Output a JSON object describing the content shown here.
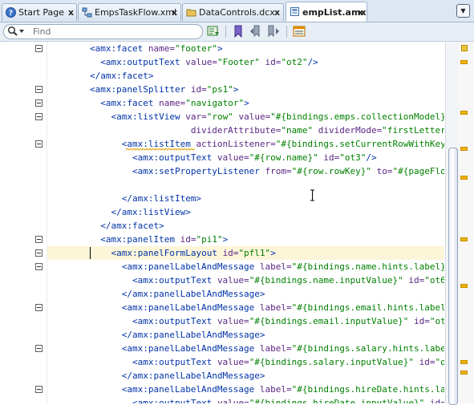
{
  "tabs": [
    {
      "label": "Start Page",
      "icon": "help-icon",
      "active": false
    },
    {
      "label": "EmpsTaskFlow.xml",
      "icon": "taskflow-icon",
      "active": false
    },
    {
      "label": "DataControls.dcx",
      "icon": "folder-icon",
      "active": false
    },
    {
      "label": "empList.amx",
      "icon": "amx-file-icon",
      "active": true
    }
  ],
  "tab_close_glyph": "x",
  "tab_menu_glyph": "▼",
  "find": {
    "placeholder": "Find",
    "value": ""
  },
  "toolbar_icons": [
    "search-options-icon",
    "bookmark-icon",
    "previous-bookmark-icon",
    "next-bookmark-icon",
    "layout-icon"
  ],
  "code_lines": [
    [
      {
        "k": "p",
        "t": "        "
      },
      {
        "k": "t",
        "t": "<amx:facet "
      },
      {
        "k": "a",
        "t": "name="
      },
      {
        "k": "v",
        "t": "\"footer\""
      },
      {
        "k": "t",
        "t": ">"
      }
    ],
    [
      {
        "k": "p",
        "t": "          "
      },
      {
        "k": "t",
        "t": "<amx:outputText "
      },
      {
        "k": "a",
        "t": "value="
      },
      {
        "k": "v",
        "t": "\"Footer\""
      },
      {
        "k": "a",
        "t": " id="
      },
      {
        "k": "v",
        "t": "\"ot2\""
      },
      {
        "k": "t",
        "t": "/>"
      }
    ],
    [
      {
        "k": "p",
        "t": "        "
      },
      {
        "k": "t",
        "t": "</amx:facet>"
      }
    ],
    [
      {
        "k": "p",
        "t": "        "
      },
      {
        "k": "t",
        "t": "<amx:panelSplitter "
      },
      {
        "k": "a",
        "t": "id="
      },
      {
        "k": "v",
        "t": "\"ps1\""
      },
      {
        "k": "t",
        "t": ">"
      }
    ],
    [
      {
        "k": "p",
        "t": "          "
      },
      {
        "k": "t",
        "t": "<amx:facet "
      },
      {
        "k": "a",
        "t": "name="
      },
      {
        "k": "v",
        "t": "\"navigator\""
      },
      {
        "k": "t",
        "t": ">"
      }
    ],
    [
      {
        "k": "p",
        "t": "            "
      },
      {
        "k": "t",
        "t": "<amx:listView "
      },
      {
        "k": "a",
        "t": "var="
      },
      {
        "k": "v",
        "t": "\"row\""
      },
      {
        "k": "a",
        "t": " value="
      },
      {
        "k": "v",
        "t": "\"#{bindings.emps.collectionModel}"
      }
    ],
    [
      {
        "k": "p",
        "t": "                           "
      },
      {
        "k": "a",
        "t": "dividerAttribute="
      },
      {
        "k": "v",
        "t": "\"name\""
      },
      {
        "k": "a",
        "t": " dividerMode="
      },
      {
        "k": "v",
        "t": "\"firstLetter\""
      }
    ],
    [
      {
        "k": "p",
        "t": "              "
      },
      {
        "k": "t",
        "t": "<amx:listItem "
      },
      {
        "k": "a",
        "t": "actionListener="
      },
      {
        "k": "v",
        "t": "\"#{bindings.setCurrentRowWithKey"
      }
    ],
    [
      {
        "k": "p",
        "t": "                "
      },
      {
        "k": "t",
        "t": "<amx:outputText "
      },
      {
        "k": "a",
        "t": "value="
      },
      {
        "k": "v",
        "t": "\"#{row.name}\""
      },
      {
        "k": "a",
        "t": " id="
      },
      {
        "k": "v",
        "t": "\"ot3\""
      },
      {
        "k": "t",
        "t": "/>"
      }
    ],
    [
      {
        "k": "p",
        "t": "                "
      },
      {
        "k": "t",
        "t": "<amx:setPropertyListener "
      },
      {
        "k": "a",
        "t": "from="
      },
      {
        "k": "v",
        "t": "\"#{row.rowKey}\""
      },
      {
        "k": "a",
        "t": " to="
      },
      {
        "k": "v",
        "t": "\"#{pageFlo"
      }
    ],
    [],
    [
      {
        "k": "p",
        "t": "              "
      },
      {
        "k": "t",
        "t": "</amx:listItem>"
      }
    ],
    [
      {
        "k": "p",
        "t": "            "
      },
      {
        "k": "t",
        "t": "</amx:listView>"
      }
    ],
    [
      {
        "k": "p",
        "t": "          "
      },
      {
        "k": "t",
        "t": "</amx:facet>"
      }
    ],
    [
      {
        "k": "p",
        "t": "          "
      },
      {
        "k": "t",
        "t": "<amx:panelItem "
      },
      {
        "k": "a",
        "t": "id="
      },
      {
        "k": "v",
        "t": "\"pi1\""
      },
      {
        "k": "t",
        "t": ">"
      }
    ],
    [
      {
        "k": "p",
        "t": "            "
      },
      {
        "k": "t",
        "t": "<amx:panelFormLayout "
      },
      {
        "k": "a",
        "t": "id="
      },
      {
        "k": "v",
        "t": "\"pfl1\""
      },
      {
        "k": "t",
        "t": ">"
      }
    ],
    [
      {
        "k": "p",
        "t": "              "
      },
      {
        "k": "t",
        "t": "<amx:panelLabelAndMessage "
      },
      {
        "k": "a",
        "t": "label="
      },
      {
        "k": "v",
        "t": "\"#{bindings.name.hints.label}"
      }
    ],
    [
      {
        "k": "p",
        "t": "                "
      },
      {
        "k": "t",
        "t": "<amx:outputText "
      },
      {
        "k": "a",
        "t": "value="
      },
      {
        "k": "v",
        "t": "\"#{bindings.name.inputValue}\""
      },
      {
        "k": "a",
        "t": " id="
      },
      {
        "k": "v",
        "t": "\"ot6"
      }
    ],
    [
      {
        "k": "p",
        "t": "              "
      },
      {
        "k": "t",
        "t": "</amx:panelLabelAndMessage>"
      }
    ],
    [
      {
        "k": "p",
        "t": "              "
      },
      {
        "k": "t",
        "t": "<amx:panelLabelAndMessage "
      },
      {
        "k": "a",
        "t": "label="
      },
      {
        "k": "v",
        "t": "\"#{bindings.email.hints.label"
      }
    ],
    [
      {
        "k": "p",
        "t": "                "
      },
      {
        "k": "t",
        "t": "<amx:outputText "
      },
      {
        "k": "a",
        "t": "value="
      },
      {
        "k": "v",
        "t": "\"#{bindings.email.inputValue}\""
      },
      {
        "k": "a",
        "t": " id="
      },
      {
        "k": "v",
        "t": "\"ot"
      }
    ],
    [
      {
        "k": "p",
        "t": "              "
      },
      {
        "k": "t",
        "t": "</amx:panelLabelAndMessage>"
      }
    ],
    [
      {
        "k": "p",
        "t": "              "
      },
      {
        "k": "t",
        "t": "<amx:panelLabelAndMessage "
      },
      {
        "k": "a",
        "t": "label="
      },
      {
        "k": "v",
        "t": "\"#{bindings.salary.hints.labe"
      }
    ],
    [
      {
        "k": "p",
        "t": "                "
      },
      {
        "k": "t",
        "t": "<amx:outputText "
      },
      {
        "k": "a",
        "t": "value="
      },
      {
        "k": "v",
        "t": "\"#{bindings.salary.inputValue}\""
      },
      {
        "k": "a",
        "t": " id="
      },
      {
        "k": "v",
        "t": "\"o"
      }
    ],
    [
      {
        "k": "p",
        "t": "              "
      },
      {
        "k": "t",
        "t": "</amx:panelLabelAndMessage>"
      }
    ],
    [
      {
        "k": "p",
        "t": "              "
      },
      {
        "k": "t",
        "t": "<amx:panelLabelAndMessage "
      },
      {
        "k": "a",
        "t": "label="
      },
      {
        "k": "v",
        "t": "\"#{bindings.hireDate.hints.la"
      }
    ],
    [
      {
        "k": "p",
        "t": "                "
      },
      {
        "k": "t",
        "t": "<amx:outputText "
      },
      {
        "k": "a",
        "t": "value="
      },
      {
        "k": "v",
        "t": "\"#{bindings.hireDate.inputValue}\""
      },
      {
        "k": "a",
        "t": " id="
      }
    ]
  ],
  "current_line": 15,
  "fold_lines": [
    0,
    3,
    4,
    5,
    7,
    14,
    15,
    16,
    19,
    22,
    25
  ],
  "colors": {
    "tag": "#0033a8",
    "attribute": "#5c2684",
    "value": "#008000",
    "current_line_bg": "#fcf5d8",
    "overview_mark": "#ecb400"
  },
  "overview_mark_levels": [
    0.05,
    0.19,
    0.29,
    0.37,
    0.54,
    0.67,
    0.88,
    0.91
  ]
}
